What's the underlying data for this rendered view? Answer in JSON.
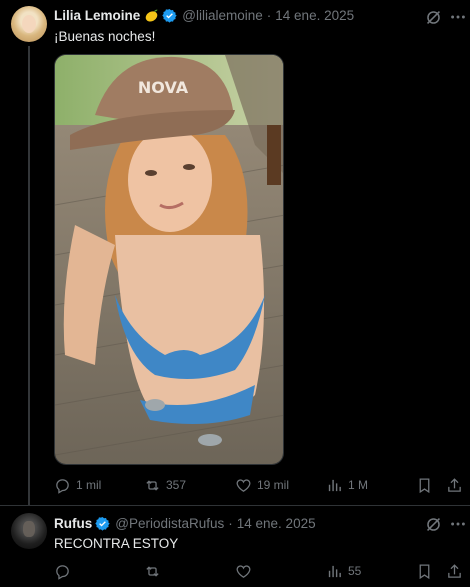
{
  "tweets": [
    {
      "author": {
        "name": "Lilia Lemoine",
        "emoji": "lemon",
        "verified": true,
        "handle": "@lilialemoine",
        "date": "14 ene. 2025"
      },
      "text": "¡Buenas noches!",
      "media": {
        "cap_text": "NOVA",
        "description_only_visual": true
      },
      "stats": {
        "replies": "1 mil",
        "reposts": "357",
        "likes": "19 mil",
        "views": "1 M"
      }
    },
    {
      "author": {
        "name": "Rufus",
        "verified": true,
        "handle": "@PeriodistaRufus",
        "date": "14 ene. 2025"
      },
      "text": "RECONTRA ESTOY",
      "stats": {
        "replies": "",
        "reposts": "",
        "likes": "",
        "views": "55"
      }
    }
  ],
  "separator": "·",
  "colors": {
    "background": "#000000",
    "text": "#e7e9ea",
    "muted": "#71767b",
    "verified": "#1d9bf0",
    "border": "#2f3336"
  }
}
